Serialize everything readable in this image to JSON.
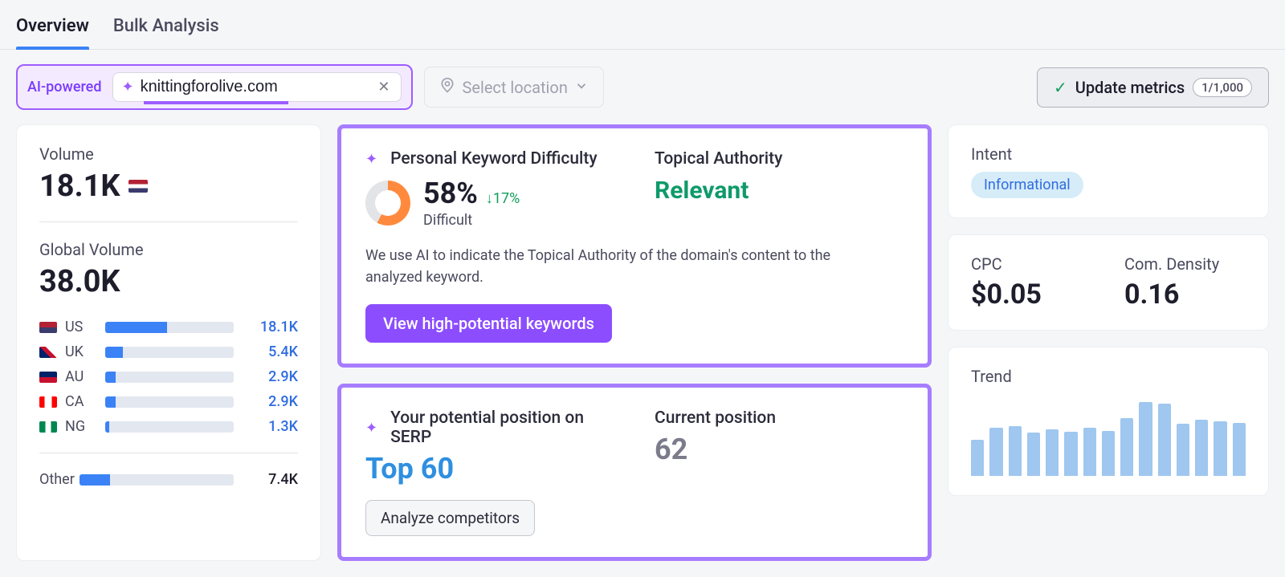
{
  "tabs": {
    "overview": "Overview",
    "bulk": "Bulk Analysis"
  },
  "toolbar": {
    "ai_label": "AI-powered",
    "domain_input": "knittingforolive.com",
    "location_placeholder": "Select location",
    "update_label": "Update metrics",
    "update_counter": "1/1,000"
  },
  "volume": {
    "label": "Volume",
    "value": "18.1K",
    "global_label": "Global Volume",
    "global_value": "38.0K",
    "rows": [
      {
        "cc": "US",
        "val": "18.1K",
        "pct": 48
      },
      {
        "cc": "UK",
        "val": "5.4K",
        "pct": 14
      },
      {
        "cc": "AU",
        "val": "2.9K",
        "pct": 8
      },
      {
        "cc": "CA",
        "val": "2.9K",
        "pct": 8
      },
      {
        "cc": "NG",
        "val": "1.3K",
        "pct": 3
      }
    ],
    "other_label": "Other",
    "other_val": "7.4K",
    "other_pct": 20
  },
  "pkd": {
    "title": "Personal Keyword Difficulty",
    "pct": "58%",
    "delta": "↓17%",
    "level": "Difficult",
    "ta_title": "Topical Authority",
    "ta_value": "Relevant",
    "note": "We use AI to indicate the Topical Authority of the domain's content to the analyzed keyword.",
    "cta": "View high-potential keywords"
  },
  "serp": {
    "potential_label": "Your potential position on SERP",
    "potential_value": "Top 60",
    "current_label": "Current position",
    "current_value": "62",
    "analyze": "Analyze competitors"
  },
  "intent": {
    "label": "Intent",
    "value": "Informational"
  },
  "cpc": {
    "label": "CPC",
    "value": "$0.05",
    "cd_label": "Com. Density",
    "cd_value": "0.16"
  },
  "trend": {
    "label": "Trend"
  },
  "chart_data": {
    "type": "bar",
    "title": "Trend",
    "values": [
      45,
      60,
      62,
      54,
      58,
      55,
      60,
      56,
      72,
      92,
      90,
      65,
      70,
      68,
      66
    ],
    "ylim": [
      0,
      100
    ]
  }
}
